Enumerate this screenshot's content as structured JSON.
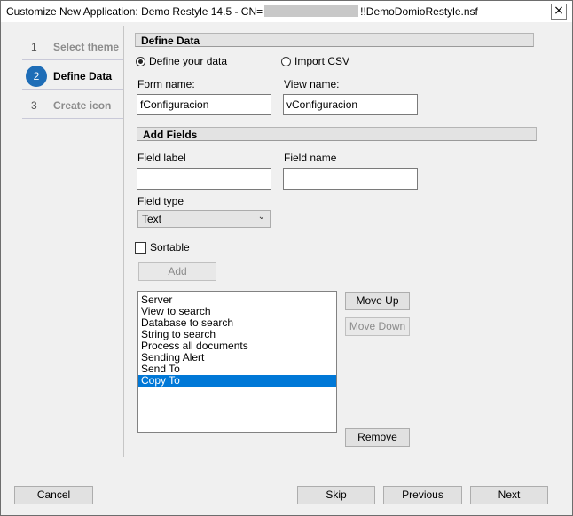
{
  "window": {
    "title_prefix": "Customize New Application: Demo Restyle 14.5 - CN=",
    "title_suffix": "!!DemoDomioRestyle.nsf",
    "close_label": "×"
  },
  "steps": [
    {
      "num": "1",
      "label": "Select theme"
    },
    {
      "num": "2",
      "label": "Define Data"
    },
    {
      "num": "3",
      "label": "Create icon"
    }
  ],
  "define_data": {
    "heading": "Define Data",
    "radio_define": "Define your data",
    "radio_import": "Import CSV",
    "form_name_label": "Form name:",
    "form_name_value": "fConfiguracion",
    "view_name_label": "View name:",
    "view_name_value": "vConfiguracion"
  },
  "add_fields": {
    "heading": "Add Fields",
    "field_label_label": "Field label",
    "field_label_value": "",
    "field_name_label": "Field name",
    "field_name_value": "",
    "field_type_label": "Field type",
    "field_type_value": "Text",
    "sortable_label": "Sortable",
    "add_button": "Add"
  },
  "fields_list": {
    "items": [
      "Server",
      "View to search",
      "Database to search",
      "String to search",
      "Process all documents",
      "Sending Alert",
      "Send To",
      "Copy To"
    ],
    "selected_index": 7
  },
  "list_buttons": {
    "move_up": "Move Up",
    "move_down": "Move Down",
    "remove": "Remove"
  },
  "footer": {
    "cancel": "Cancel",
    "skip": "Skip",
    "previous": "Previous",
    "next": "Next"
  }
}
